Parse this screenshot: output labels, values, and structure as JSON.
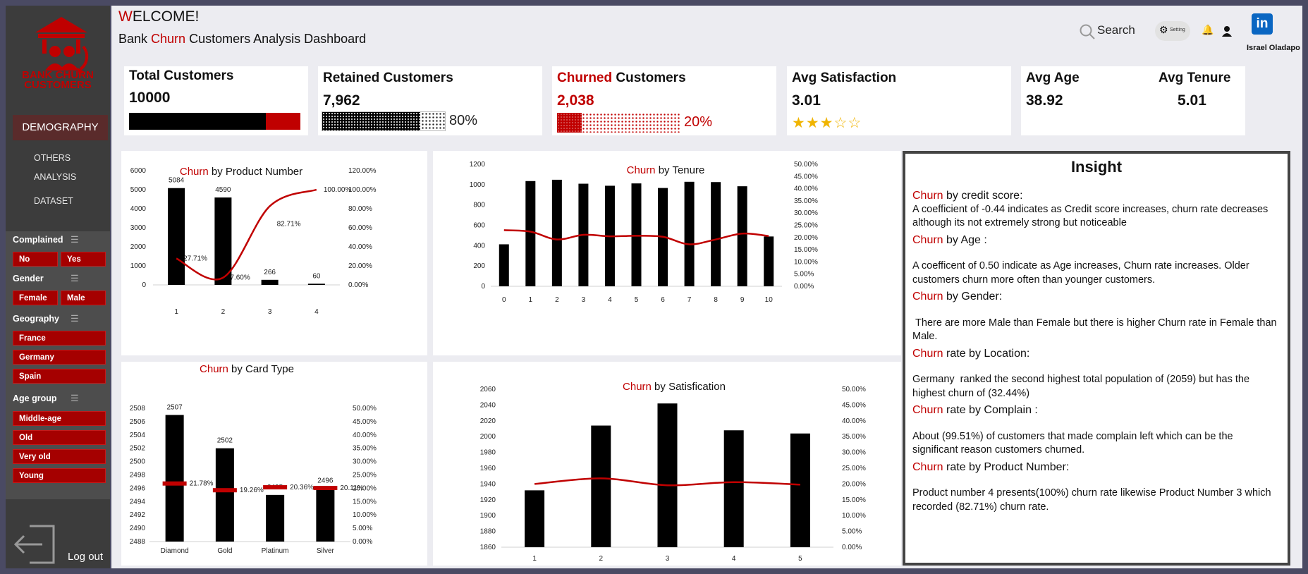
{
  "header": {
    "welcome_w": "W",
    "welcome_rest": "ELCOME!",
    "subtitle_pre": "Bank ",
    "subtitle_red": "Churn",
    "subtitle_post": " Customers Analysis Dashboard",
    "search_label": "Search",
    "setting_label": "Setting",
    "user_name": "Israel Oladapo"
  },
  "sidebar": {
    "logo_line1": "BANK CHURN",
    "logo_line2": "CUSTOMERS",
    "nav": [
      {
        "label": "DEMOGRAPHY",
        "active": true
      },
      {
        "label": "OTHERS"
      },
      {
        "label": "ANALYSIS"
      },
      {
        "label": "DATASET"
      }
    ],
    "slicers": [
      {
        "title": "Complained",
        "options": [
          "No",
          "Yes"
        ]
      },
      {
        "title": "Gender",
        "options": [
          "Female",
          "Male"
        ]
      },
      {
        "title": "Geography",
        "options": [
          "France",
          "Germany",
          "Spain"
        ]
      },
      {
        "title": "Age group",
        "options": [
          "Middle-age",
          "Old",
          "Very old",
          "Young"
        ]
      }
    ],
    "logout_label": "Log out"
  },
  "kpis": {
    "total": {
      "title": "Total Customers",
      "value": "10000",
      "retained_fraction": 0.8
    },
    "retained": {
      "title": "Retained Customers",
      "value": "7,962",
      "pct": "80%",
      "fraction": 0.8
    },
    "churned": {
      "title_red": "Churned",
      "title_rest": " Customers",
      "value": "2,038",
      "pct": "20%",
      "fraction": 0.2
    },
    "satisfaction": {
      "title": "Avg Satisfaction",
      "value": "3.01",
      "stars": 3.01,
      "stars_max": 5,
      "filled_glyph": "★",
      "empty_glyph": "☆"
    },
    "age": {
      "title": "Avg Age",
      "value": "38.92"
    },
    "tenure": {
      "title": "Avg Tenure",
      "value": "5.01"
    }
  },
  "colors": {
    "accent": "#c00000",
    "bar": "#000000",
    "line": "#c00000"
  },
  "chart_data": [
    {
      "id": "product",
      "type": "bar",
      "title_red": "Churn",
      "title_rest": " by Product Number",
      "categories": [
        "1",
        "2",
        "3",
        "4"
      ],
      "series": [
        {
          "name": "Customers",
          "values": [
            5084,
            4590,
            266,
            60
          ]
        },
        {
          "name": "Churn rate",
          "values": [
            27.71,
            7.6,
            82.71,
            100
          ],
          "labels": [
            "27.71%",
            "7.60%",
            "82.71%",
            "100.00%"
          ]
        }
      ],
      "ylim": [
        0,
        6000
      ],
      "yticks": [
        0,
        1000,
        2000,
        3000,
        4000,
        5000,
        6000
      ],
      "y2lim": [
        0,
        120
      ],
      "y2ticks": [
        "0.00%",
        "20.00%",
        "40.00%",
        "60.00%",
        "80.00%",
        "100.00%",
        "120.00%"
      ]
    },
    {
      "id": "tenure",
      "type": "bar",
      "title_red": "Churn",
      "title_rest": " by Tenure",
      "categories": [
        "0",
        "1",
        "2",
        "3",
        "4",
        "5",
        "6",
        "7",
        "8",
        "9",
        "10"
      ],
      "series": [
        {
          "name": "Customers",
          "values": [
            413,
            1035,
            1048,
            1009,
            989,
            1012,
            967,
            1028,
            1025,
            984,
            490
          ]
        },
        {
          "name": "Churn rate",
          "values": [
            23.0,
            22.4,
            19.2,
            21.1,
            20.5,
            20.7,
            20.3,
            17.2,
            19.2,
            21.6,
            20.6
          ]
        }
      ],
      "ylim": [
        0,
        1200
      ],
      "yticks": [
        0,
        200,
        400,
        600,
        800,
        1000,
        1200
      ],
      "y2lim": [
        0,
        50
      ],
      "y2ticks": [
        "0.00%",
        "5.00%",
        "10.00%",
        "15.00%",
        "20.00%",
        "25.00%",
        "30.00%",
        "35.00%",
        "40.00%",
        "45.00%",
        "50.00%"
      ]
    },
    {
      "id": "card",
      "type": "bar",
      "title_red": "Churn",
      "title_rest": " by Card Type",
      "categories": [
        "Diamond",
        "Gold",
        "Platinum",
        "Silver"
      ],
      "series": [
        {
          "name": "Customers",
          "values": [
            2507,
            2502,
            2495,
            2496
          ]
        },
        {
          "name": "Churn rate",
          "values": [
            21.78,
            19.26,
            20.36,
            20.11
          ],
          "labels": [
            "21.78%",
            "19.26%",
            "20.36%",
            "20.11%"
          ]
        }
      ],
      "ylim": [
        2488,
        2508
      ],
      "yticks": [
        2488,
        2490,
        2492,
        2494,
        2496,
        2498,
        2500,
        2502,
        2504,
        2506,
        2508
      ],
      "y2lim": [
        0,
        50
      ],
      "y2ticks": [
        "0.00%",
        "5.00%",
        "10.00%",
        "15.00%",
        "20.00%",
        "25.00%",
        "30.00%",
        "35.00%",
        "40.00%",
        "45.00%",
        "50.00%"
      ]
    },
    {
      "id": "satisfaction",
      "type": "bar",
      "title_red": "Churn",
      "title_rest": " by Satisfication",
      "categories": [
        "1",
        "2",
        "3",
        "4",
        "5"
      ],
      "series": [
        {
          "name": "Customers",
          "values": [
            1932,
            2014,
            2042,
            2008,
            2004
          ]
        },
        {
          "name": "Churn rate",
          "values": [
            20.0,
            21.8,
            19.6,
            20.6,
            19.8
          ]
        }
      ],
      "ylim": [
        1860,
        2060
      ],
      "yticks": [
        1860,
        1880,
        1900,
        1920,
        1940,
        1960,
        1980,
        2000,
        2020,
        2040,
        2060
      ],
      "y2lim": [
        0,
        50
      ],
      "y2ticks": [
        "0.00%",
        "5.00%",
        "10.00%",
        "15.00%",
        "20.00%",
        "25.00%",
        "30.00%",
        "35.00%",
        "40.00%",
        "45.00%",
        "50.00%"
      ]
    }
  ],
  "insight": {
    "title": "Insight",
    "sections": [
      {
        "head_red": "Churn",
        "head_rest": " by credit score:",
        "text": "A coefficient of -0.44 indicates as Credit score increases, churn rate decreases although its not extremely strong but noticeable",
        "gap": false
      },
      {
        "head_red": "Churn",
        "head_rest": " by Age :",
        "text": "A coefficent of 0.50 indicate as Age increases, Churn rate increases. Older customers churn more often than younger customers.",
        "gap": true
      },
      {
        "head_red": "Churn",
        "head_rest": " by Gender:",
        "text": " There are more Male than Female but there is higher Churn rate in Female than Male.",
        "gap": true
      },
      {
        "head_red": "Churn",
        "head_rest": " rate by Location:",
        "text": "Germany  ranked the second highest total population of (2059) but has the highest churn of (32.44%)",
        "gap": true
      },
      {
        "head_red": " Churn",
        "head_rest": " rate by Complain :",
        "text": "About (99.51%) of customers that made complain left which can be the significant reason customers churned.",
        "gap": true
      },
      {
        "head_red": "Churn",
        "head_rest": " rate by Product Number:",
        "text": "Product number 4 presents(100%) churn rate likewise Product Number 3 which recorded (82.71%) churn rate.",
        "gap": true
      }
    ]
  }
}
